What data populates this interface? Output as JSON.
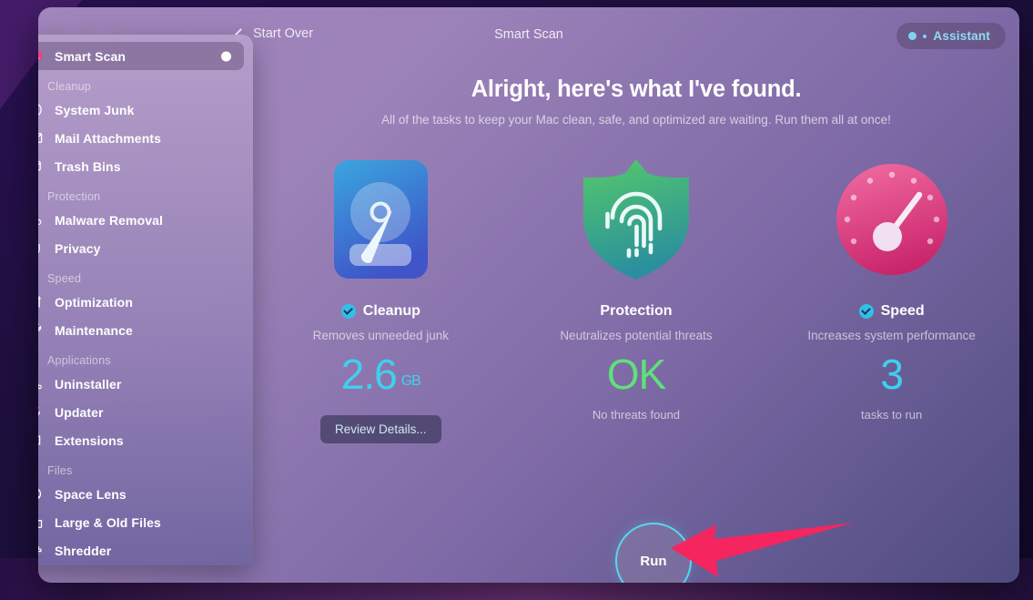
{
  "window": {
    "title": "Smart Scan",
    "back_label": "Start Over",
    "assistant_label": "Assistant",
    "accent_cyan": "#3fd0f0",
    "accent_green": "#5fe07a"
  },
  "sidebar": {
    "top_item": {
      "label": "Smart Scan",
      "icon": "monitor-scan-icon",
      "active": true,
      "has_status_dot": true
    },
    "sections": [
      {
        "heading": "Cleanup",
        "items": [
          {
            "label": "System Junk",
            "icon": "junk-icon"
          },
          {
            "label": "Mail Attachments",
            "icon": "envelope-icon"
          },
          {
            "label": "Trash Bins",
            "icon": "trash-bin-icon"
          }
        ]
      },
      {
        "heading": "Protection",
        "items": [
          {
            "label": "Malware Removal",
            "icon": "biohazard-icon"
          },
          {
            "label": "Privacy",
            "icon": "hand-icon"
          }
        ]
      },
      {
        "heading": "Speed",
        "items": [
          {
            "label": "Optimization",
            "icon": "sliders-icon"
          },
          {
            "label": "Maintenance",
            "icon": "wrench-icon"
          }
        ]
      },
      {
        "heading": "Applications",
        "items": [
          {
            "label": "Uninstaller",
            "icon": "uninstaller-icon"
          },
          {
            "label": "Updater",
            "icon": "refresh-arrow-icon"
          },
          {
            "label": "Extensions",
            "icon": "puzzle-piece-icon"
          }
        ]
      },
      {
        "heading": "Files",
        "items": [
          {
            "label": "Space Lens",
            "icon": "planet-icon"
          },
          {
            "label": "Large & Old Files",
            "icon": "folder-icon"
          },
          {
            "label": "Shredder",
            "icon": "shredder-icon"
          }
        ]
      }
    ]
  },
  "main": {
    "headline": "Alright, here's what I've found.",
    "subhead": "All of the tasks to keep your Mac clean, safe, and optimized are waiting. Run them all at once!",
    "cards": [
      {
        "title": "Cleanup",
        "icon": "hard-disk-icon",
        "checked": true,
        "description": "Removes unneeded junk",
        "value": "2.6",
        "unit": "GB",
        "value_color": "cyan",
        "footer": "",
        "button_label": "Review Details..."
      },
      {
        "title": "Protection",
        "icon": "shield-fingerprint-icon",
        "checked": false,
        "description": "Neutralizes potential threats",
        "value": "OK",
        "unit": "",
        "value_color": "green",
        "footer": "No threats found",
        "button_label": ""
      },
      {
        "title": "Speed",
        "icon": "speed-gauge-icon",
        "checked": true,
        "description": "Increases system performance",
        "value": "3",
        "unit": "",
        "value_color": "cyan",
        "footer": "tasks to run",
        "button_label": ""
      }
    ],
    "run_label": "Run"
  },
  "annotation": {
    "arrow_color": "#f5255f",
    "points_to": "run-button"
  }
}
